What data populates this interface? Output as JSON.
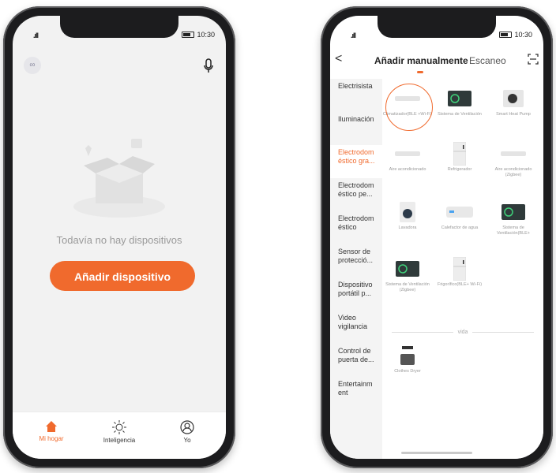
{
  "left_phone": {
    "status": {
      "signal": ".ıll",
      "time": "10:30"
    },
    "empty_message": "Todavía no hay dispositivos",
    "add_button": "Añadir dispositivo",
    "tabs": [
      {
        "label": "Mi hogar"
      },
      {
        "label": "Inteligencia"
      },
      {
        "label": "Yo"
      }
    ]
  },
  "right_phone": {
    "status": {
      "signal": ".ıll",
      "time": "10:30"
    },
    "header": {
      "back": "<",
      "tab_manual": "Añadir manualmente",
      "tab_scan": "Escaneo"
    },
    "categories": [
      "Electrisista",
      "Iluminación",
      "Electrodom éstico gra...",
      "Electrodom éstico pe...",
      "Electrodom éstico",
      "Sensor de protecció...",
      "Dispositivo portátil p...",
      "Video vigilancia",
      "Control de puerta de...",
      "Entertainm ent"
    ],
    "active_category": "Electrodom éstico gra...",
    "devices": [
      "Climatizador(BLE +Wi-Fi)",
      "Sistema de Ventilación",
      "Smart Heat Pump",
      "Aire acondicionado",
      "Refrigerador",
      "Aire acondicionado (Zigbee)",
      "Lavadora",
      "Calefactor de agua",
      "Sistema de Ventilación(BLE+",
      "Sistema de Ventilación (Zigbee)",
      "Frigorífico(BLE+ Wi-Fi)"
    ],
    "section": "vida",
    "section_devices": [
      "Clothes Dryer"
    ]
  },
  "colors": {
    "accent": "#f06a2d"
  }
}
